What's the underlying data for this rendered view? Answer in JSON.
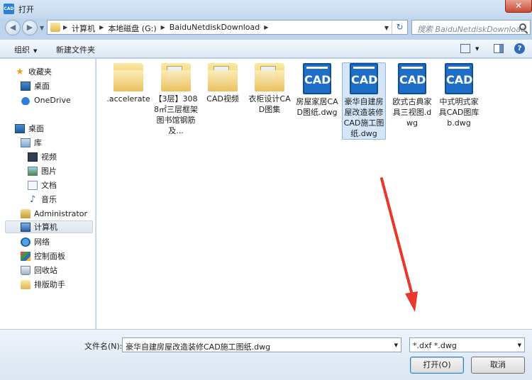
{
  "window": {
    "title": "打开",
    "app_icon": "CAD",
    "close_symbol": "✕"
  },
  "address": {
    "crumbs": [
      "计算机",
      "本地磁盘 (G:)",
      "BaiduNetdiskDownload"
    ],
    "search_placeholder": "搜索 BaiduNetdiskDownload"
  },
  "toolbar": {
    "organize": "组织",
    "new_folder": "新建文件夹"
  },
  "nav": {
    "favorites": "收藏夹",
    "fav_desktop": "桌面",
    "onedrive": "OneDrive",
    "desktop": "桌面",
    "library": "库",
    "video": "视频",
    "pictures": "图片",
    "documents": "文档",
    "music": "音乐",
    "administrator": "Administrator",
    "computer": "计算机",
    "network": "网络",
    "control_panel": "控制面板",
    "recycle_bin": "回收站",
    "typeset_helper": "排版助手"
  },
  "files": [
    {
      "name": ".accelerate",
      "type": "folder"
    },
    {
      "name": "【3层】3088㎡三层框架图书馆钢筋及...",
      "type": "folder"
    },
    {
      "name": "CAD视频",
      "type": "folder"
    },
    {
      "name": "衣柜设计CAD图集",
      "type": "folder"
    },
    {
      "name": "房屋家居CAD图纸.dwg",
      "type": "cad",
      "icon_text": "CAD"
    },
    {
      "name": "豪华自建房屋改造装修CAD施工图纸.dwg",
      "type": "cad",
      "icon_text": "CAD",
      "selected": true
    },
    {
      "name": "欧式古典家具三视图.dwg",
      "type": "cad",
      "icon_text": "CAD"
    },
    {
      "name": "中式明式家具CAD图库b.dwg",
      "type": "cad",
      "icon_text": "CAD"
    }
  ],
  "footer": {
    "filename_label": "文件名(N):",
    "filename_value": "豪华自建房屋改造装修CAD施工图纸.dwg",
    "filter_value": "*.dxf *.dwg",
    "open_button": "打开(O)",
    "cancel_button": "取消"
  },
  "colors": {
    "annotation_arrow": "#e8382c",
    "selection": "#d4e6f8",
    "cad_icon": "#1e6ec8"
  }
}
